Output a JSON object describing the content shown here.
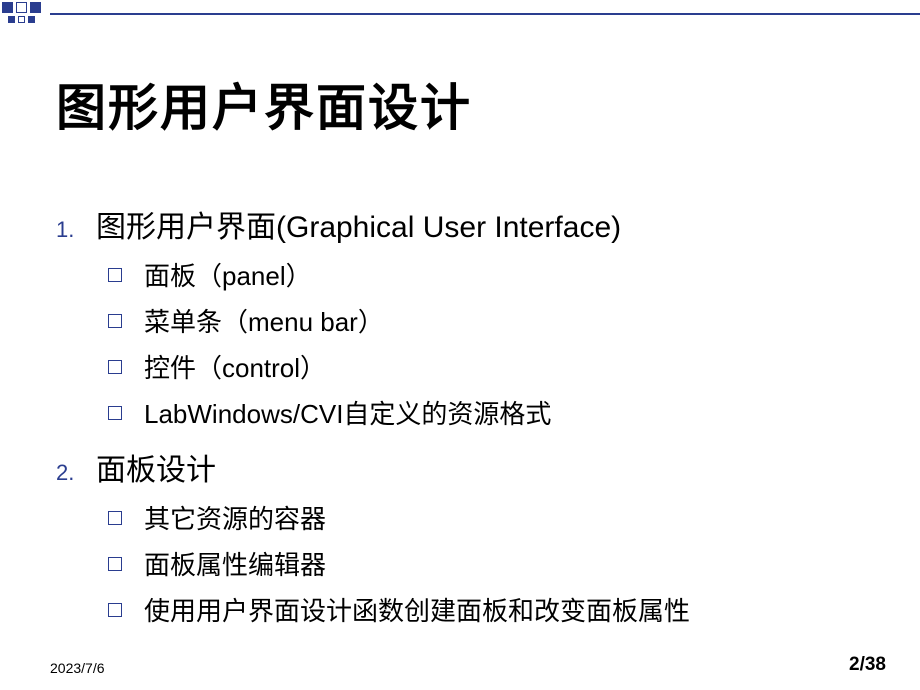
{
  "title": "图形用户界面设计",
  "items": [
    {
      "number": "1.",
      "text": "图形用户界面(Graphical User Interface)",
      "subitems": [
        "面板（panel）",
        "菜单条（menu bar）",
        "控件（control）",
        "LabWindows/CVI自定义的资源格式"
      ]
    },
    {
      "number": "2.",
      "text": "面板设计",
      "subitems": [
        "其它资源的容器",
        "面板属性编辑器",
        "使用用户界面设计函数创建面板和改变面板属性"
      ]
    }
  ],
  "footer": {
    "date": "2023/7/6",
    "page": "2/38"
  }
}
